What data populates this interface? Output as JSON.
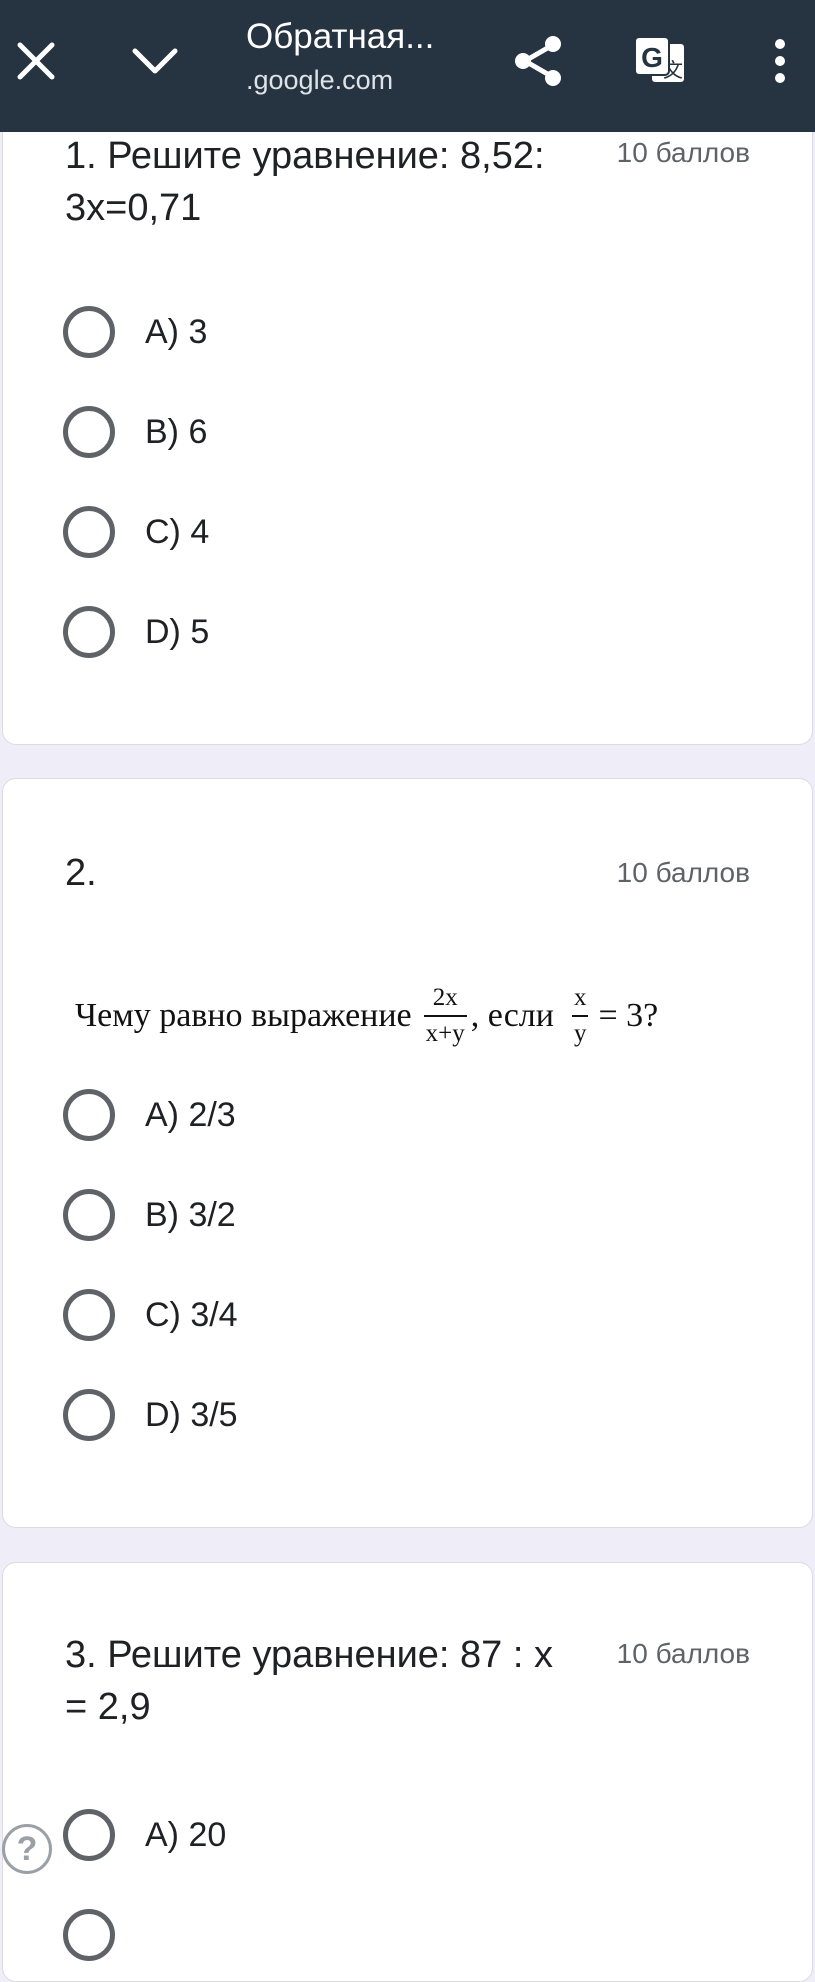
{
  "browser": {
    "title": "Обратная...",
    "domain": ".google.com",
    "icons": {
      "close": "close-icon",
      "collapse": "chevron-down-icon",
      "share": "share-icon",
      "translate": "translate-icon",
      "more": "more-vert-icon"
    },
    "translate_glyph": "G"
  },
  "questions": [
    {
      "title": "1. Решите уравнение: 8,52: 3x=0,71",
      "points": "10 баллов",
      "options": [
        "A) 3",
        "B) 6",
        "C) 4",
        "D) 5"
      ]
    },
    {
      "title": "2.",
      "points": "10 баллов",
      "formula": {
        "lead": "Чему равно выражение",
        "frac1_num": "2x",
        "frac1_den": "x+y",
        "mid": ", если",
        "frac2_num": "x",
        "frac2_den": "y",
        "tail": "= 3?"
      },
      "options": [
        "A) 2/3",
        "B) 3/2",
        "C) 3/4",
        "D) 3/5"
      ]
    },
    {
      "title": "3. Решите уравнение:  87 : x = 2,9",
      "points": "10 баллов",
      "options": [
        "A) 20"
      ]
    }
  ],
  "help": {
    "glyph": "?"
  },
  "colors": {
    "topbar": "#263341",
    "page_bg": "#eeedf8",
    "card_bg": "#ffffff",
    "radio_border": "#5f6368"
  }
}
